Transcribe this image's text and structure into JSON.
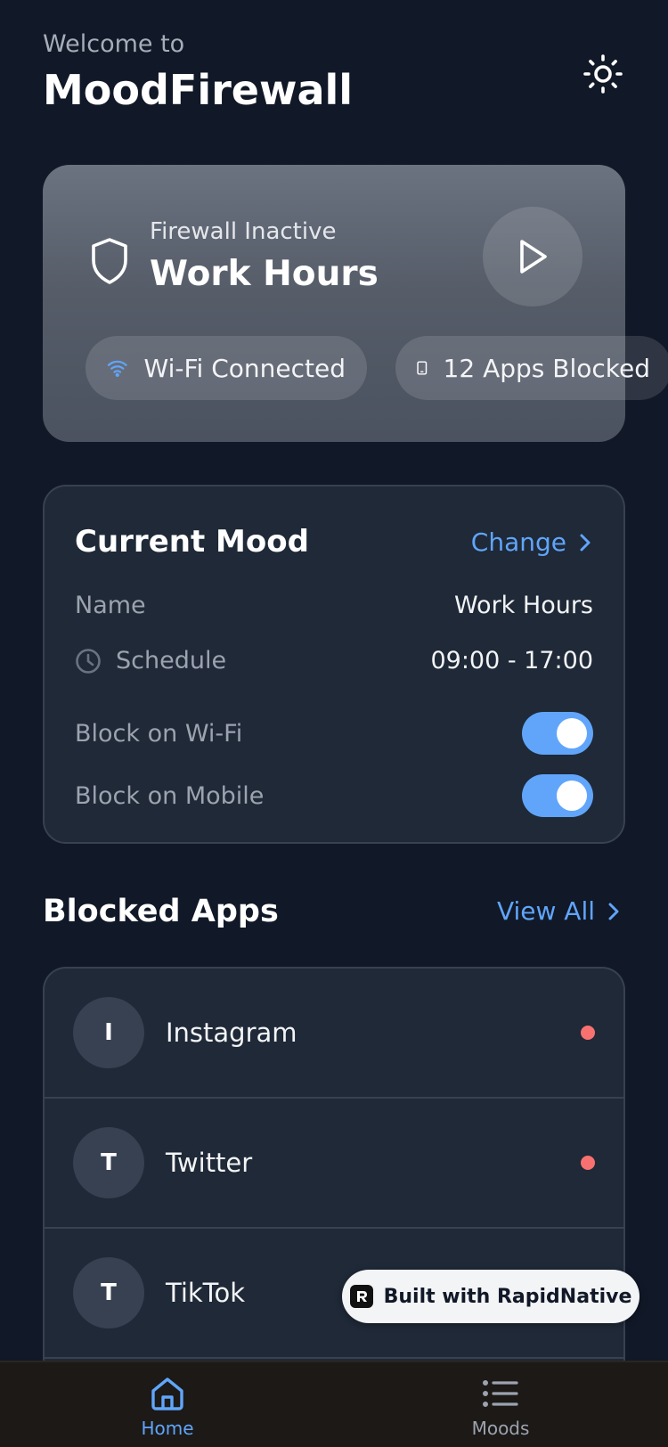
{
  "header": {
    "welcome": "Welcome to",
    "title": "MoodFirewall",
    "theme_icon": "sun-icon"
  },
  "status": {
    "label": "Firewall Inactive",
    "mood": "Work Hours",
    "wifi_chip": "Wi-Fi Connected",
    "apps_chip": "12 Apps Blocked"
  },
  "current_mood": {
    "title": "Current Mood",
    "change_label": "Change",
    "rows": {
      "name_label": "Name",
      "name_value": "Work Hours",
      "schedule_label": "Schedule",
      "schedule_value": "09:00 - 17:00",
      "wifi_label": "Block on Wi-Fi",
      "wifi_on": true,
      "mobile_label": "Block on Mobile",
      "mobile_on": true
    }
  },
  "blocked_apps": {
    "title": "Blocked Apps",
    "view_all_label": "View All",
    "items": [
      {
        "initial": "I",
        "name": "Instagram",
        "status_dot": true
      },
      {
        "initial": "T",
        "name": "Twitter",
        "status_dot": true
      },
      {
        "initial": "T",
        "name": "TikTok",
        "status_dot": false
      }
    ]
  },
  "badge": {
    "label": "Built with RapidNative"
  },
  "tabbar": {
    "tabs": [
      {
        "label": "Home",
        "active": true
      },
      {
        "label": "Moods",
        "active": false
      }
    ]
  },
  "colors": {
    "background": "#111827",
    "card": "#1f2937",
    "accent": "#60a5fa",
    "danger_dot": "#f87171"
  }
}
